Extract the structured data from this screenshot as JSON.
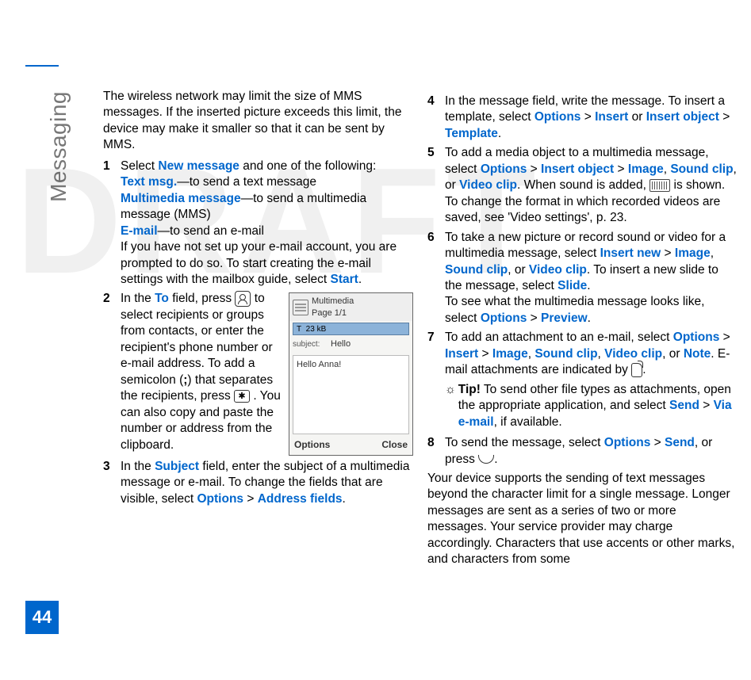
{
  "section_title": "Messaging",
  "page_number": "44",
  "watermark": "DRAFT",
  "col1": {
    "intro": "The wireless network may limit the size of MMS messages. If the inserted picture exceeds this limit, the device may make it smaller so that it can be sent by MMS.",
    "step1": {
      "lead": "Select ",
      "kw1": "New message",
      "after1": " and one of the following:",
      "kw2": "Text msg.",
      "after2": "—to send a text message",
      "kw3": "Multimedia message",
      "after3": "—to send a multimedia message (MMS)",
      "kw4": "E-mail",
      "after4": "—to send an e-mail",
      "rest": "If you have not set up your e-mail account, you are prompted to do so. To start creating the e-mail settings with the mailbox guide, select ",
      "kw5": "Start",
      "period": "."
    },
    "step2": {
      "a": "In the ",
      "kw_to": "To",
      "b": " field, press ",
      "c": " to select recipients or groups from contacts, or enter the recipient's phone number or e-mail address. To add a semicolon (",
      "semi": ";",
      "d": ") that separates the recipients, press ",
      "e": " . You can also copy and paste the number or address from the clipboard."
    },
    "step3": {
      "a": "In the ",
      "kw_sub": "Subject",
      "b": " field, enter the subject of a multimedia message or e-mail. To change the fields that are visible, select ",
      "kw_opt": "Options",
      "gt": " > ",
      "kw_af": "Address fields",
      "p": "."
    }
  },
  "col2": {
    "step4": {
      "a": "In the message field, write the message. To insert a template, select ",
      "kw_opt": "Options",
      "gt": " > ",
      "kw_ins": "Insert",
      "or": " or ",
      "kw_insobj": "Insert object",
      "gt2": " > ",
      "kw_tmpl": "Template",
      "p": "."
    },
    "step5": {
      "a": "To add a media object to a multimedia message, select ",
      "kw_opt": "Options",
      "gt": " > ",
      "kw_insobj": "Insert object",
      "gt2": " > ",
      "kw_img": "Image",
      "c1": ", ",
      "kw_sc": "Sound clip",
      "c2": ", or ",
      "kw_vc": "Video clip",
      "p": ". When sound is added, ",
      "shown": " is shown.",
      "rest": "To change the format in which recorded videos are saved, see 'Video settings', p. 23."
    },
    "step6": {
      "a": "To take a new picture or record sound or video for a multimedia message, select ",
      "kw_insnew": "Insert new",
      "gt": " > ",
      "kw_img": "Image",
      "c1": ", ",
      "kw_sc": "Sound clip",
      "c2": ", or ",
      "kw_vc": "Video clip",
      "b": ". To insert a new slide to the message, select ",
      "kw_slide": "Slide",
      "p": ".",
      "rest1": "To see what the multimedia message looks like, select ",
      "kw_opt": "Options",
      "gt2": " > ",
      "kw_prev": "Preview",
      "p2": "."
    },
    "step7": {
      "a": "To add an attachment to an e-mail, select ",
      "kw_opt": "Options",
      "gt": " > ",
      "kw_ins": "Insert",
      "gt2": " > ",
      "kw_img": "Image",
      "c1": ", ",
      "kw_sc": "Sound clip",
      "c2": ", ",
      "kw_vc": "Video clip",
      "c3": ", or ",
      "kw_note": "Note",
      "b": ". E-mail attachments are indicated by ",
      "p": "."
    },
    "tip": {
      "label": "Tip!",
      "text": " To send other file types as attachments, open the appropriate application, and select ",
      "kw_send": "Send",
      "gt": " > ",
      "kw_via": "Via e-mail",
      "rest": ", if available."
    },
    "step8": {
      "a": "To send the message, select ",
      "kw_opt": "Options",
      "gt": " > ",
      "kw_send": "Send",
      "b": ", or press ",
      "p": "."
    },
    "outro": "Your device supports the sending of text messages beyond the character limit for a single message. Longer messages are sent as a series of two or more messages. Your service provider may charge accordingly. Characters that use accents or other marks, and characters from some"
  },
  "screenshot": {
    "title1": "Multimedia",
    "title2": "Page 1/1",
    "size": "23 kB",
    "subject_label": "subject:",
    "subject_value": "Hello",
    "body": "Hello Anna!",
    "left_soft": "Options",
    "right_soft": "Close"
  }
}
